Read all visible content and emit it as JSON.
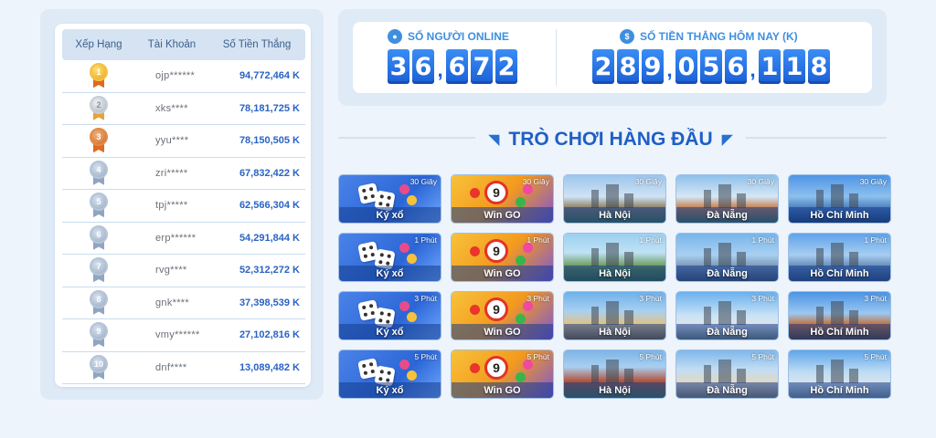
{
  "leaderboard": {
    "headers": {
      "rank": "Xếp Hạng",
      "account": "Tài Khoản",
      "winnings": "Số Tiền Thắng"
    },
    "rows": [
      {
        "rank": "1",
        "account": "ojp******",
        "amount": "94,772,464 K",
        "medal": "gold"
      },
      {
        "rank": "2",
        "account": "xks****",
        "amount": "78,181,725 K",
        "medal": "silver"
      },
      {
        "rank": "3",
        "account": "yyu****",
        "amount": "78,150,505 K",
        "medal": "bronze"
      },
      {
        "rank": "4",
        "account": "zri*****",
        "amount": "67,832,422 K",
        "medal": "blue"
      },
      {
        "rank": "5",
        "account": "tpj*****",
        "amount": "62,566,304 K",
        "medal": "blue"
      },
      {
        "rank": "6",
        "account": "erp******",
        "amount": "54,291,844 K",
        "medal": "blue"
      },
      {
        "rank": "7",
        "account": "rvg****",
        "amount": "52,312,272 K",
        "medal": "blue"
      },
      {
        "rank": "8",
        "account": "gnk****",
        "amount": "37,398,539 K",
        "medal": "blue"
      },
      {
        "rank": "9",
        "account": "vmy******",
        "amount": "27,102,816 K",
        "medal": "blue"
      },
      {
        "rank": "10",
        "account": "dnf****",
        "amount": "13,089,482 K",
        "medal": "blue"
      }
    ]
  },
  "stats": {
    "online_label": "SỐ NGƯỜI ONLINE",
    "online_value": "36,672",
    "today_label": "SỐ TIỀN THẮNG HÔM NAY (K)",
    "today_value": "289,056,118"
  },
  "top_games": {
    "title": "TRÒ CHƠI HÀNG ĐẦU",
    "rows": [
      [
        {
          "name": "Ký xổ",
          "time": "30 Giây",
          "art": "kyxo",
          "bg": "bg-kyxo"
        },
        {
          "name": "Win GO",
          "time": "30 Giây",
          "art": "wingo",
          "bg": "bg-wingo"
        },
        {
          "name": "Hà Nội",
          "time": "30 Giây",
          "art": "city",
          "bg": "bg-hn"
        },
        {
          "name": "Đà Nẵng",
          "time": "30 Giây",
          "art": "city",
          "bg": "bg-dn"
        },
        {
          "name": "Hồ Chí Minh",
          "time": "30 Giây",
          "art": "city",
          "bg": "bg-hcm"
        }
      ],
      [
        {
          "name": "Ký xổ",
          "time": "1 Phút",
          "art": "kyxo",
          "bg": "bg-kyxo"
        },
        {
          "name": "Win GO",
          "time": "1 Phút",
          "art": "wingo",
          "bg": "bg-wingo"
        },
        {
          "name": "Hà Nội",
          "time": "1 Phút",
          "art": "city",
          "bg": "bg-hn2"
        },
        {
          "name": "Đà Nẵng",
          "time": "1 Phút",
          "art": "city",
          "bg": "bg-dn2"
        },
        {
          "name": "Hồ Chí Minh",
          "time": "1 Phút",
          "art": "city",
          "bg": "bg-hcm2"
        }
      ],
      [
        {
          "name": "Ký xổ",
          "time": "3 Phút",
          "art": "kyxo",
          "bg": "bg-kyxo"
        },
        {
          "name": "Win GO",
          "time": "3 Phút",
          "art": "wingo",
          "bg": "bg-wingo"
        },
        {
          "name": "Hà Nội",
          "time": "3 Phút",
          "art": "city",
          "bg": "bg-hn3"
        },
        {
          "name": "Đà Nẵng",
          "time": "3 Phút",
          "art": "city",
          "bg": "bg-dn3"
        },
        {
          "name": "Hồ Chí Minh",
          "time": "3 Phút",
          "art": "city",
          "bg": "bg-hcm3"
        }
      ],
      [
        {
          "name": "Ký xổ",
          "time": "5 Phút",
          "art": "kyxo",
          "bg": "bg-kyxo"
        },
        {
          "name": "Win GO",
          "time": "5 Phút",
          "art": "wingo",
          "bg": "bg-wingo"
        },
        {
          "name": "Hà Nội",
          "time": "5 Phút",
          "art": "city",
          "bg": "bg-hn4"
        },
        {
          "name": "Đà Nẵng",
          "time": "5 Phút",
          "art": "city",
          "bg": "bg-dn4"
        },
        {
          "name": "Hồ Chí Minh",
          "time": "5 Phút",
          "art": "city",
          "bg": "bg-hcm4"
        }
      ]
    ]
  },
  "colors": {
    "accent": "#1f5fc7",
    "digit_bg": "#2a74e6",
    "amount": "#2a63c4"
  }
}
